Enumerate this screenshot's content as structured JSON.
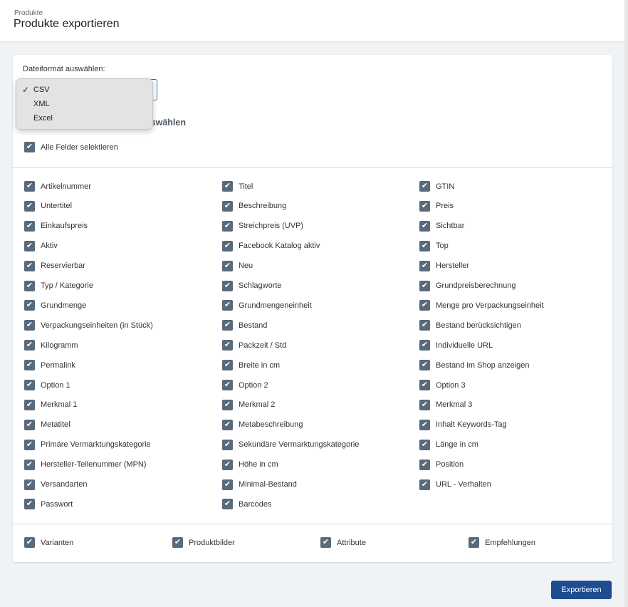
{
  "header": {
    "breadcrumb": "Produkte",
    "title": "Produkte exportieren"
  },
  "format": {
    "label": "Dateiformat auswählen:",
    "selected": "CSV",
    "options": [
      "CSV",
      "XML",
      "Excel"
    ]
  },
  "fields_heading": "Felder auswählen",
  "select_all": {
    "label": "Alle Felder selektieren",
    "checked": true
  },
  "fields": [
    [
      "Artikelnummer",
      "Untertitel",
      "Einkaufspreis",
      "Aktiv",
      "Reservierbar",
      "Typ / Kategorie",
      "Grundmenge",
      "Verpackungseinheiten (in Stück)",
      "Kilogramm",
      "Permalink",
      "Option 1",
      "Merkmal 1",
      "Metatitel",
      "Primäre Vermarktungskategorie",
      "Hersteller-Teilenummer (MPN)",
      "Versandarten",
      "Passwort"
    ],
    [
      "Titel",
      "Beschreibung",
      "Streichpreis (UVP)",
      "Facebook Katalog aktiv",
      "Neu",
      "Schlagworte",
      "Grundmengeneinheit",
      "Bestand",
      "Packzeit / Std",
      "Breite in cm",
      "Option 2",
      "Merkmal 2",
      "Metabeschreibung",
      "Sekundäre Vermarktungskategorie",
      "Höhe in cm",
      "Minimal-Bestand",
      "Barcodes"
    ],
    [
      "GTIN",
      "Preis",
      "Sichtbar",
      "Top",
      "Hersteller",
      "Grundpreisberechnung",
      "Menge pro Verpackungseinheit",
      "Bestand berücksichtigen",
      "Individuelle URL",
      "Bestand im Shop anzeigen",
      "Option 3",
      "Merkmal 3",
      "Inhalt Keywords-Tag",
      "Länge in cm",
      "Position",
      "URL - Verhalten"
    ]
  ],
  "extras": [
    "Varianten",
    "Produktbilder",
    "Attribute",
    "Empfehlungen"
  ],
  "export_button": "Exportieren",
  "colors": {
    "checkbox": "#586a7b",
    "primary": "#1d4c8f",
    "focus": "#2f6fd1"
  }
}
